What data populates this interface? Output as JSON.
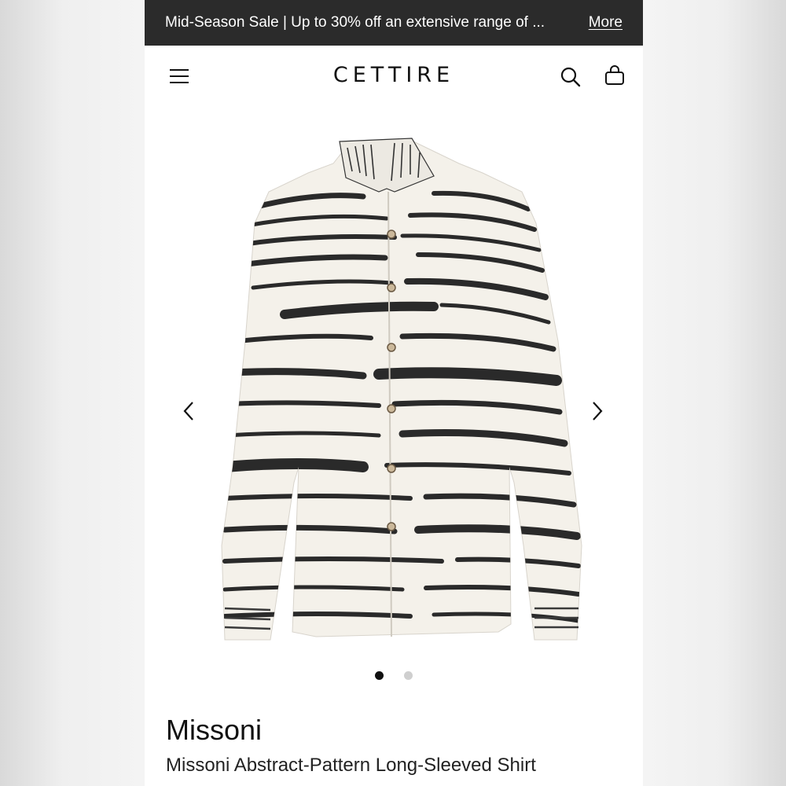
{
  "banner": {
    "text": "Mid-Season Sale | Up to 30% off an extensive range of ...",
    "more_label": "More"
  },
  "header": {
    "logo": "CETTIRE",
    "icons": [
      "menu-icon",
      "search-icon",
      "shopping-bag-icon"
    ]
  },
  "gallery": {
    "image_count": 2,
    "active_index": 1,
    "arrow_icons": [
      "chevron-left-icon",
      "chevron-right-icon"
    ]
  },
  "product": {
    "brand": "Missoni",
    "name": "Missoni Abstract-Pattern Long-Sleeved Shirt"
  },
  "colors": {
    "banner_bg": "#2b2b2b",
    "text": "#111111",
    "dot_active": "#111111",
    "dot_inactive": "#cfcfcf"
  }
}
